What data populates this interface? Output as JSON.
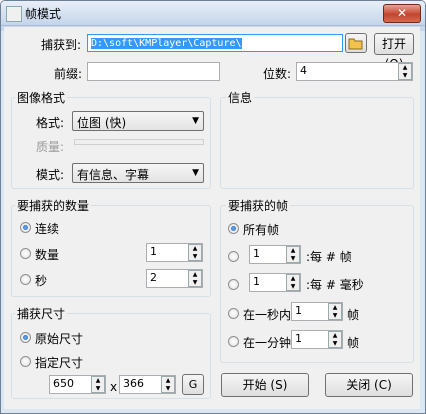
{
  "window": {
    "title": "帧模式",
    "close": "✕"
  },
  "capture": {
    "label": "捕获到:",
    "path": "D:\\soft\\KMPlayer\\Capture\\",
    "open_button": "打开 (O)",
    "prefix_label": "前缀:",
    "prefix_value": "",
    "digits_label": "位数:",
    "digits_value": "4"
  },
  "image_format": {
    "title": "图像格式",
    "format_label": "格式:",
    "format_value": "位图 (快)",
    "quality_label": "质量:",
    "mode_label": "模式:",
    "mode_value": "有信息、字幕"
  },
  "info": {
    "title": "信息"
  },
  "capture_count": {
    "title": "要捕获的数量",
    "continuous": "连续",
    "count": "数量",
    "count_value": "1",
    "seconds": "秒",
    "seconds_value": "2",
    "selected": "continuous"
  },
  "capture_size": {
    "title": "捕获尺寸",
    "original": "原始尺寸",
    "specified": "指定尺寸",
    "width_value": "650",
    "times": "x",
    "height_value": "366",
    "g_button": "G"
  },
  "frames": {
    "title": "要捕获的帧",
    "all": "所有帧",
    "every_n_frames_value": "1",
    "every_n_frames_label": ":每 # 帧",
    "every_n_ms_value": "1",
    "every_n_ms_label": ":每 # 毫秒",
    "per_second_label": "在一秒内",
    "per_second_value": "1",
    "per_second_unit": "帧",
    "per_minute_label": "在一分钟",
    "per_minute_value": "1",
    "per_minute_unit": "帧"
  },
  "buttons": {
    "start": "开始 (S)",
    "close": "关闭 (C)"
  }
}
